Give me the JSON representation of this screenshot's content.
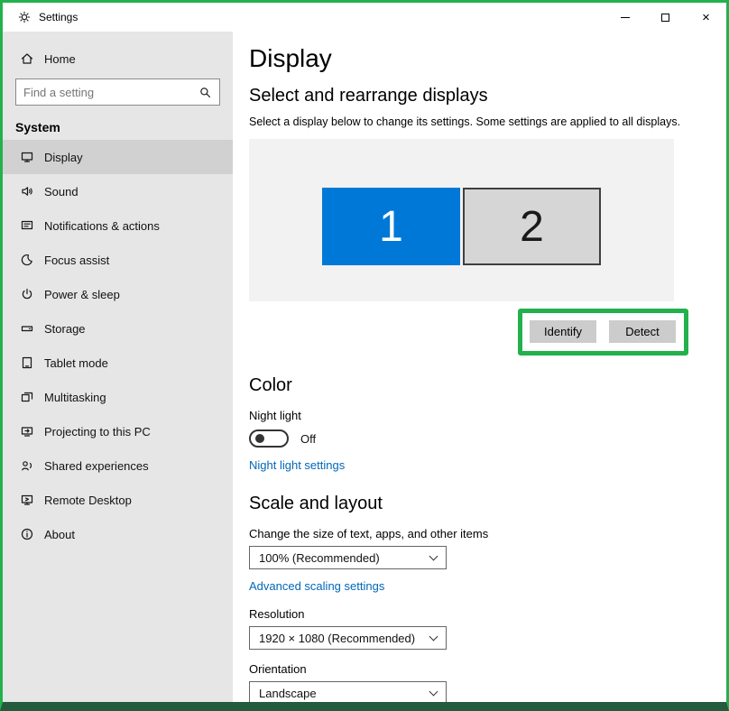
{
  "window": {
    "title": "Settings",
    "close_glyph": "×"
  },
  "sidebar": {
    "home_label": "Home",
    "search_placeholder": "Find a setting",
    "section": "System",
    "items": [
      {
        "label": "Display",
        "icon": "display-icon",
        "selected": true
      },
      {
        "label": "Sound",
        "icon": "sound-icon",
        "selected": false
      },
      {
        "label": "Notifications & actions",
        "icon": "notifications-icon",
        "selected": false
      },
      {
        "label": "Focus assist",
        "icon": "focus-assist-icon",
        "selected": false
      },
      {
        "label": "Power & sleep",
        "icon": "power-icon",
        "selected": false
      },
      {
        "label": "Storage",
        "icon": "storage-icon",
        "selected": false
      },
      {
        "label": "Tablet mode",
        "icon": "tablet-mode-icon",
        "selected": false
      },
      {
        "label": "Multitasking",
        "icon": "multitasking-icon",
        "selected": false
      },
      {
        "label": "Projecting to this PC",
        "icon": "projecting-icon",
        "selected": false
      },
      {
        "label": "Shared experiences",
        "icon": "shared-experiences-icon",
        "selected": false
      },
      {
        "label": "Remote Desktop",
        "icon": "remote-desktop-icon",
        "selected": false
      },
      {
        "label": "About",
        "icon": "about-icon",
        "selected": false
      }
    ]
  },
  "main": {
    "page_title": "Display",
    "rearrange": {
      "heading": "Select and rearrange displays",
      "description": "Select a display below to change its settings. Some settings are applied to all displays.",
      "monitors": [
        {
          "number": "1",
          "selected": true
        },
        {
          "number": "2",
          "selected": false
        }
      ],
      "identify_button": "Identify",
      "detect_button": "Detect"
    },
    "color_section": {
      "heading": "Color",
      "night_light_label": "Night light",
      "night_light_state": "Off",
      "night_light_link": "Night light settings"
    },
    "scale_section": {
      "heading": "Scale and layout",
      "scale_label": "Change the size of text, apps, and other items",
      "scale_value": "100% (Recommended)",
      "advanced_link": "Advanced scaling settings",
      "resolution_label": "Resolution",
      "resolution_value": "1920 × 1080 (Recommended)",
      "orientation_label": "Orientation",
      "orientation_value": "Landscape"
    }
  },
  "colors": {
    "accent_blue": "#0078d7",
    "link_blue": "#0067b8",
    "annotation_green": "#22b14c",
    "frame_green": "#22b14c",
    "footer_green": "#235b3c",
    "sidebar_gray": "#e6e6e6",
    "selected_item_gray": "#d1d1d1",
    "button_gray": "#cccccc",
    "preview_gray": "#f2f2f2"
  }
}
